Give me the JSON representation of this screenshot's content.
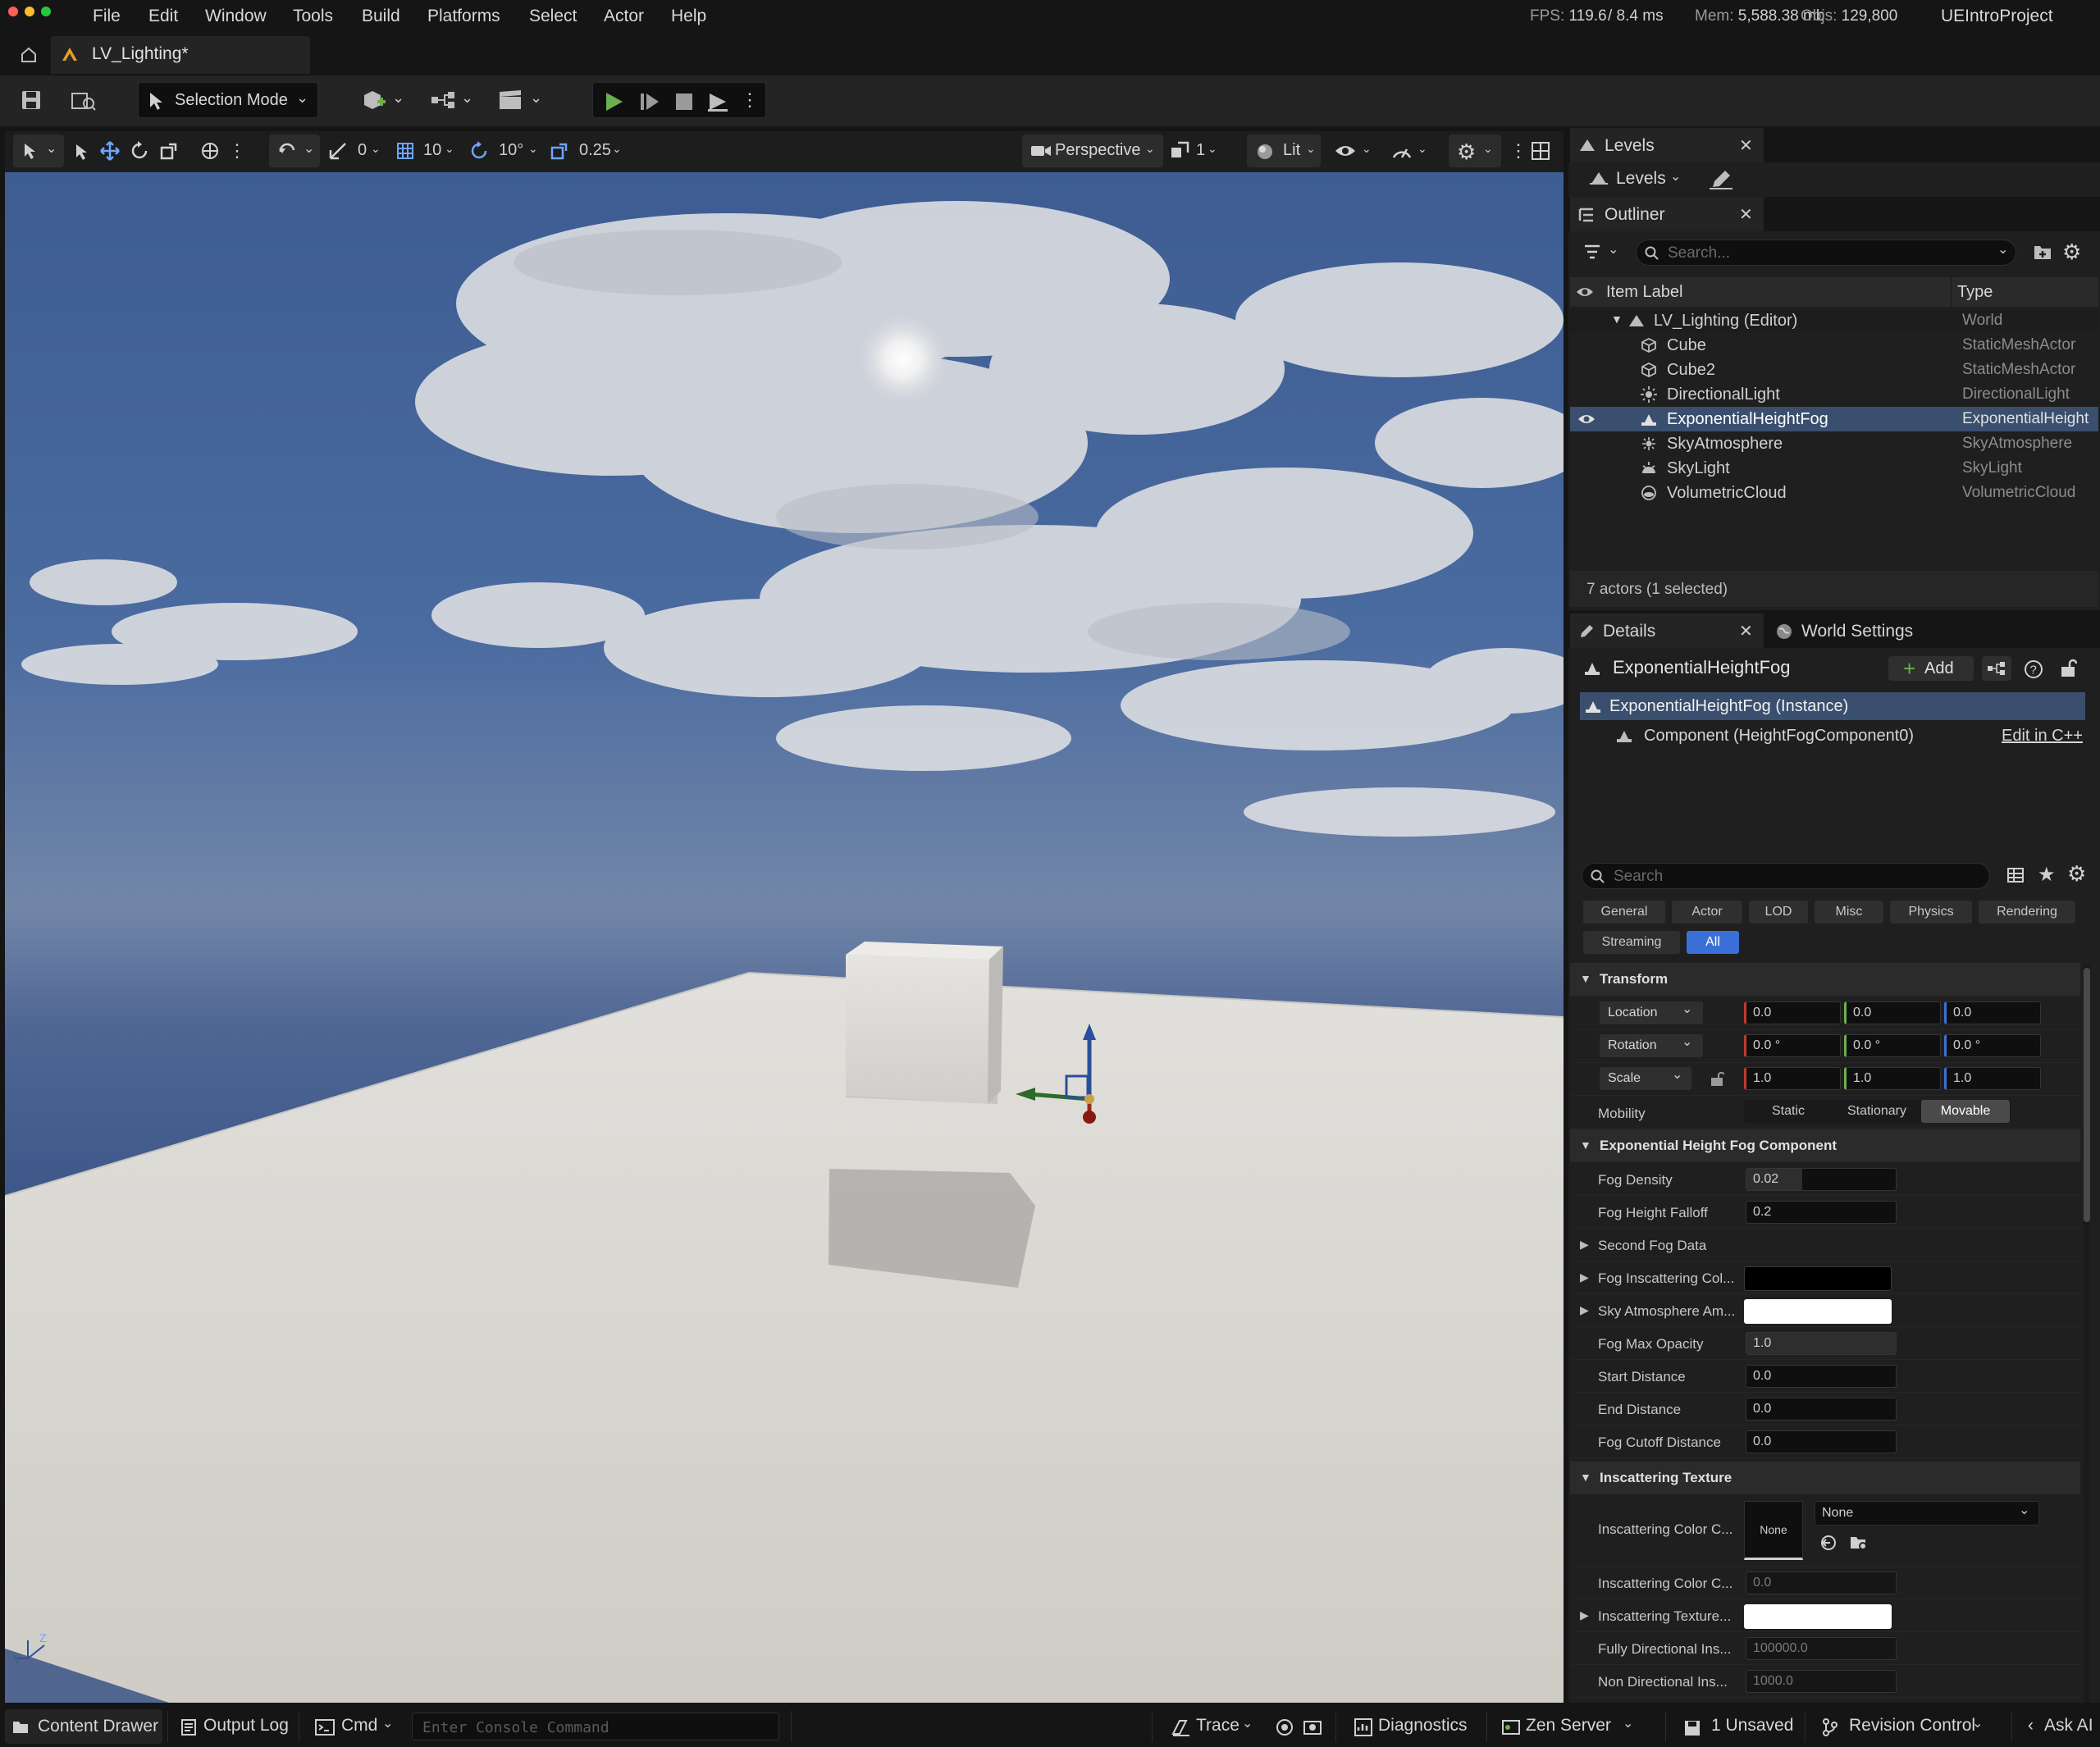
{
  "menubar": {
    "items": [
      "File",
      "Edit",
      "Window",
      "Tools",
      "Build",
      "Platforms",
      "Select",
      "Actor",
      "Help"
    ],
    "stats": {
      "fps_label": "FPS:",
      "fps": "119.6",
      "ms": "/ 8.4 ms",
      "mem_label": "Mem:",
      "mem": "5,588.38 mb",
      "objs_label": "Objs:",
      "objs": "129,800"
    },
    "project": "UEIntroProject"
  },
  "tab": {
    "title": "LV_Lighting*"
  },
  "toolbar": {
    "selection_mode": "Selection Mode"
  },
  "viewport_toolbar": {
    "rotate_snap": "0",
    "grid": "10",
    "angle": "10°",
    "scale": "0.25",
    "perspective": "Perspective",
    "count": "1",
    "lit": "Lit"
  },
  "levels": {
    "tab": "Levels",
    "dropdown": "Levels"
  },
  "outliner": {
    "tab": "Outliner",
    "search_placeholder": "Search...",
    "col_label": "Item Label",
    "col_type": "Type",
    "rows": [
      {
        "label": "LV_Lighting (Editor)",
        "type": "World"
      },
      {
        "label": "Cube",
        "type": "StaticMeshActor"
      },
      {
        "label": "Cube2",
        "type": "StaticMeshActor"
      },
      {
        "label": "DirectionalLight",
        "type": "DirectionalLight"
      },
      {
        "label": "ExponentialHeightFog",
        "type": "ExponentialHeight"
      },
      {
        "label": "SkyAtmosphere",
        "type": "SkyAtmosphere"
      },
      {
        "label": "SkyLight",
        "type": "SkyLight"
      },
      {
        "label": "VolumetricCloud",
        "type": "VolumetricCloud"
      }
    ],
    "footer": "7 actors (1 selected)"
  },
  "details": {
    "tab": "Details",
    "world_tab": "World Settings",
    "actor_name": "ExponentialHeightFog",
    "add_label": "Add",
    "instance": "ExponentialHeightFog (Instance)",
    "component": "Component (HeightFogComponent0)",
    "edit_cpp": "Edit in C++",
    "search_placeholder": "Search",
    "filters": [
      "General",
      "Actor",
      "LOD",
      "Misc",
      "Physics",
      "Rendering",
      "Streaming",
      "All"
    ],
    "transform": {
      "title": "Transform",
      "location_label": "Location",
      "location": [
        "0.0",
        "0.0",
        "0.0"
      ],
      "rotation_label": "Rotation",
      "rotation": [
        "0.0 °",
        "0.0 °",
        "0.0 °"
      ],
      "scale_label": "Scale",
      "scale": [
        "1.0",
        "1.0",
        "1.0"
      ],
      "mobility_label": "Mobility",
      "mobility_options": [
        "Static",
        "Stationary",
        "Movable"
      ]
    },
    "fog_component": {
      "title": "Exponential Height Fog Component",
      "fog_density_label": "Fog Density",
      "fog_density": "0.02",
      "fog_height_falloff_label": "Fog Height Falloff",
      "fog_height_falloff": "0.2",
      "second_fog_label": "Second Fog Data",
      "inscattering_color_label": "Fog Inscattering Col...",
      "sky_atmosphere_label": "Sky Atmosphere Am...",
      "max_opacity_label": "Fog Max Opacity",
      "max_opacity": "1.0",
      "start_distance_label": "Start Distance",
      "start_distance": "0.0",
      "end_distance_label": "End Distance",
      "end_distance": "0.0",
      "cutoff_label": "Fog Cutoff Distance",
      "cutoff": "0.0"
    },
    "inscattering_texture": {
      "title": "Inscattering Texture",
      "cubemap_label": "Inscattering Color C...",
      "thumb": "None",
      "dropdown": "None",
      "angle_label": "Inscattering Color C...",
      "angle": "0.0",
      "tint_label": "Inscattering Texture...",
      "fully_dir_label": "Fully Directional Ins...",
      "fully_dir": "100000.0",
      "non_dir_label": "Non Directional Ins...",
      "non_dir": "1000.0"
    }
  },
  "statusbar": {
    "content_drawer": "Content Drawer",
    "output_log": "Output Log",
    "cmd": "Cmd",
    "console_placeholder": "Enter Console Command",
    "trace": "Trace",
    "diagnostics": "Diagnostics",
    "zen": "Zen Server",
    "unsaved": "1 Unsaved",
    "revision": "Revision Control",
    "ask_ai": "Ask AI"
  },
  "colors": {
    "accent": "#3b6fd8",
    "play_green": "#6ab04c",
    "selection": "#3a4e6e",
    "movable": "#4a4a4a"
  }
}
